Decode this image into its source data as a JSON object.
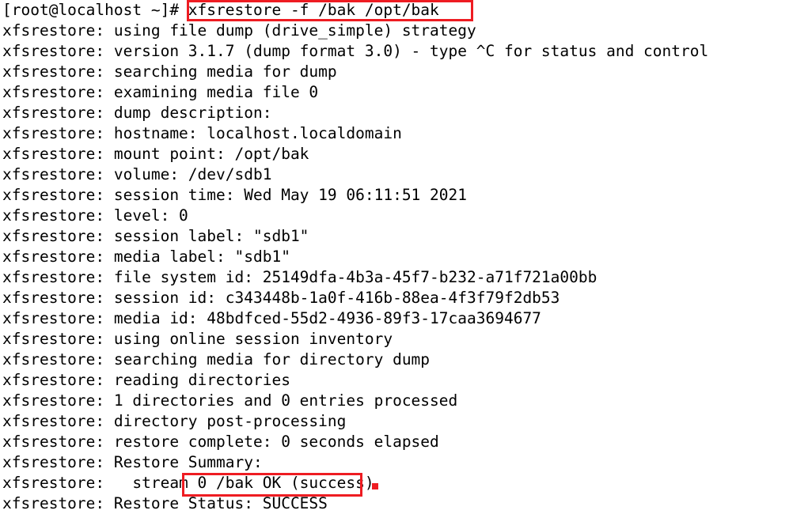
{
  "terminal": {
    "prompt": "[root@localhost ~]#",
    "command": "xfsrestore -f /bak /opt/bak",
    "accent_color": "#ee1c22",
    "background_color": "#ffffff",
    "text_color": "#000000",
    "lines": [
      "[root@localhost ~]# xfsrestore -f /bak /opt/bak",
      "xfsrestore: using file dump (drive_simple) strategy",
      "xfsrestore: version 3.1.7 (dump format 3.0) - type ^C for status and control",
      "xfsrestore: searching media for dump",
      "xfsrestore: examining media file 0",
      "xfsrestore: dump description:",
      "xfsrestore: hostname: localhost.localdomain",
      "xfsrestore: mount point: /opt/bak",
      "xfsrestore: volume: /dev/sdb1",
      "xfsrestore: session time: Wed May 19 06:11:51 2021",
      "xfsrestore: level: 0",
      "xfsrestore: session label: \"sdb1\"",
      "xfsrestore: media label: \"sdb1\"",
      "xfsrestore: file system id: 25149dfa-4b3a-45f7-b232-a71f721a00bb",
      "xfsrestore: session id: c343448b-1a0f-416b-88ea-4f3f79f2db53",
      "xfsrestore: media id: 48bdfced-55d2-4936-89f3-17caa3694677",
      "xfsrestore: using online session inventory",
      "xfsrestore: searching media for directory dump",
      "xfsrestore: reading directories",
      "xfsrestore: 1 directories and 0 entries processed",
      "xfsrestore: directory post-processing",
      "xfsrestore: restore complete: 0 seconds elapsed",
      "xfsrestore: Restore Summary:",
      "xfsrestore:   stream 0 /bak OK (success)",
      "xfsrestore: Restore Status: SUCCESS"
    ],
    "annotations": {
      "command_box_label": "xfsrestore -f /bak /opt/bak",
      "status_box_label": "Status: SUCCESS"
    }
  }
}
